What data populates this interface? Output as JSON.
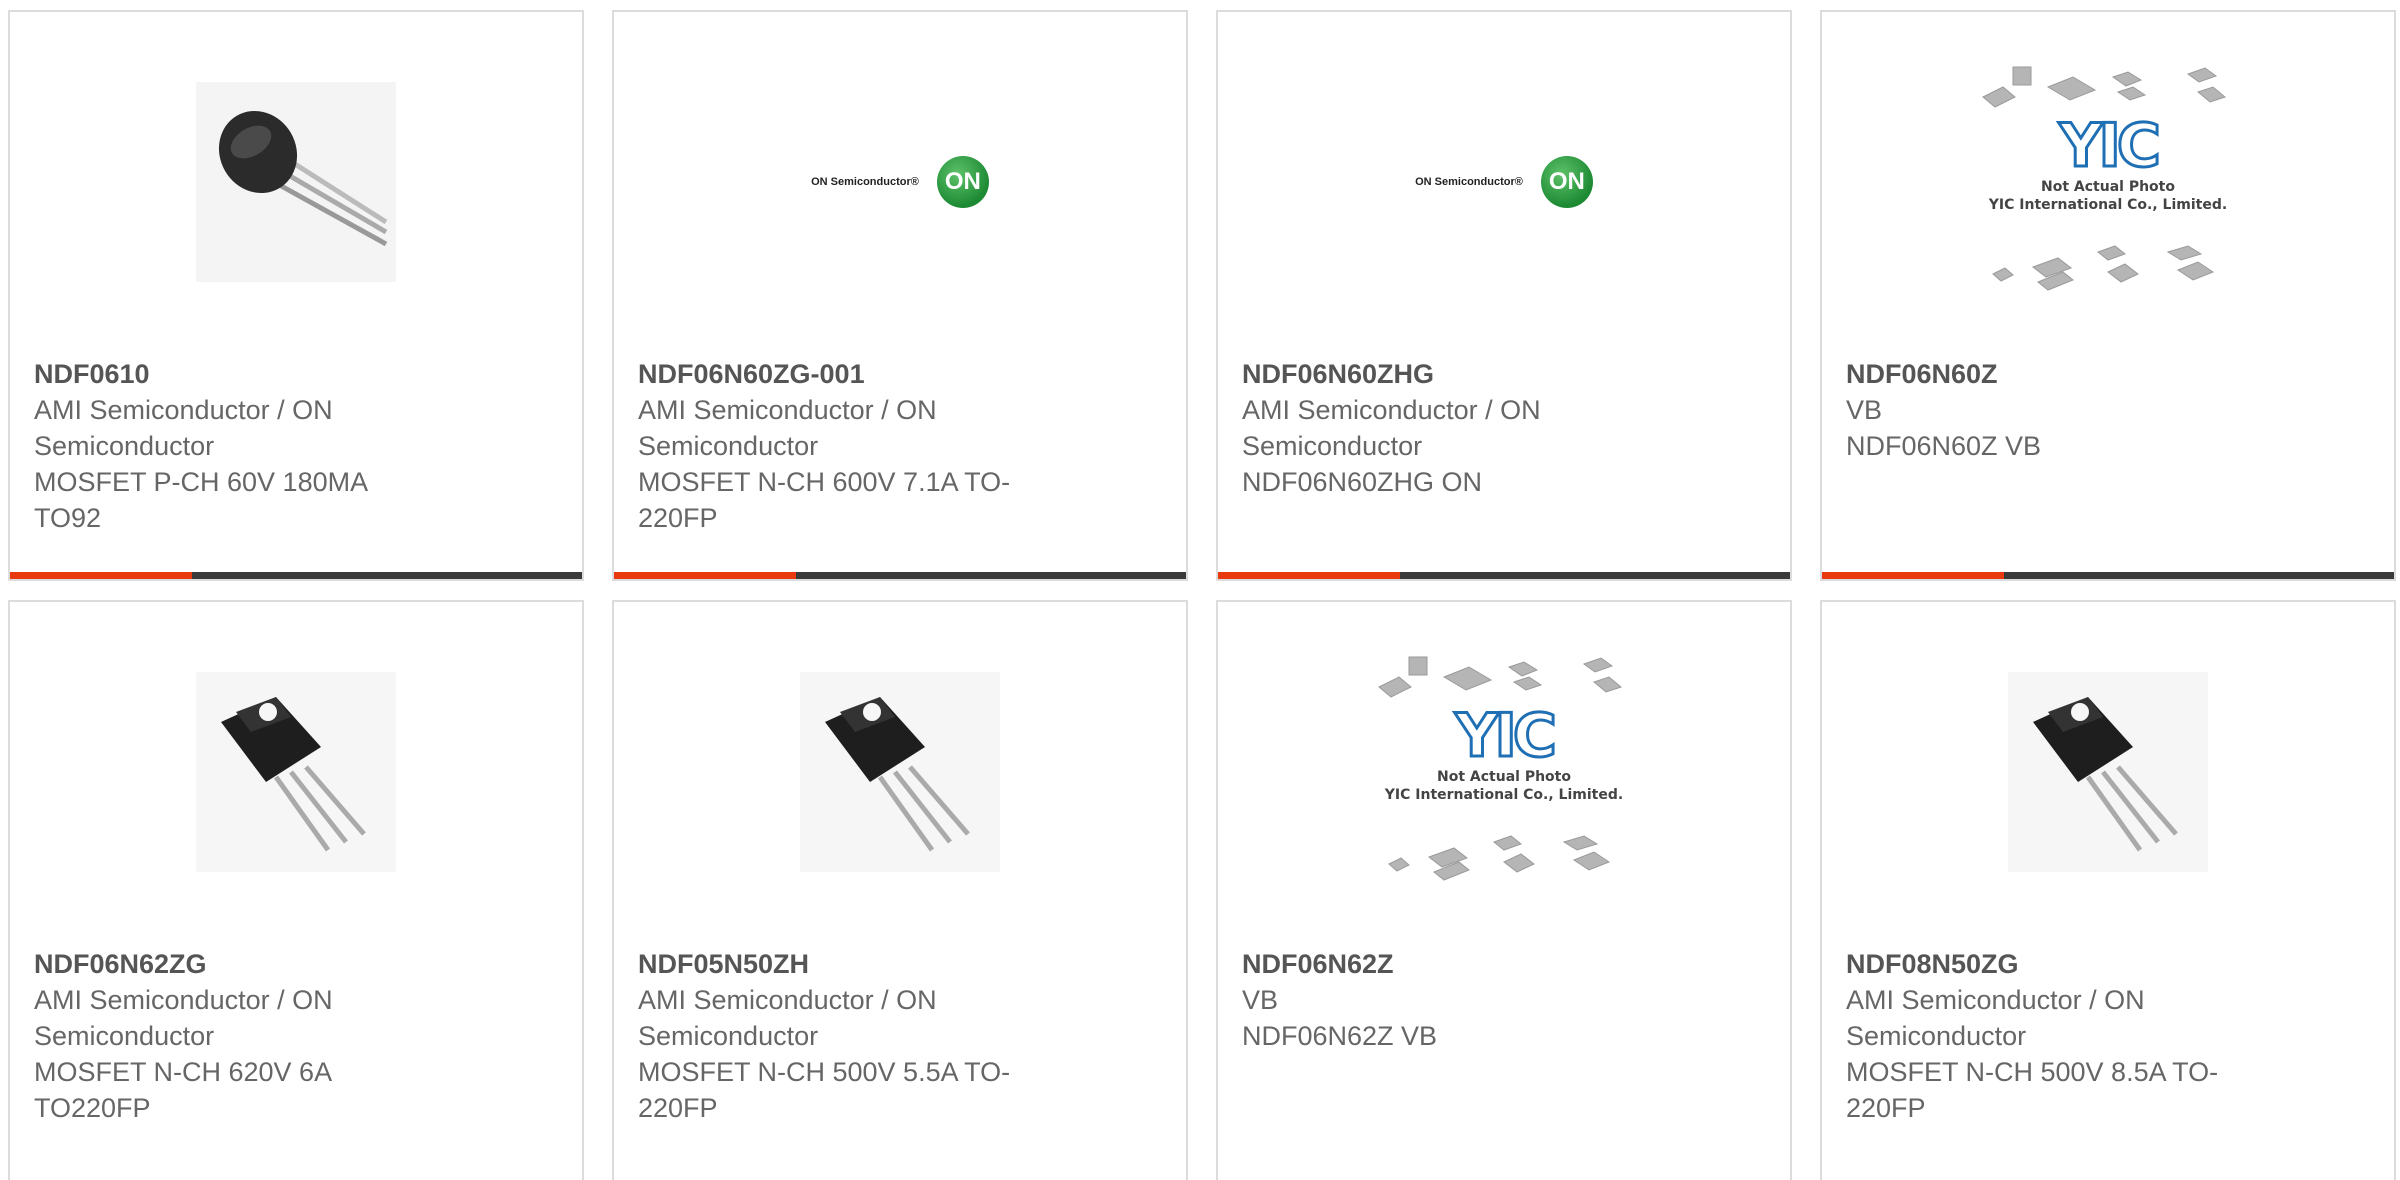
{
  "colors": {
    "accent": "#e8380d",
    "bar": "#3a3a3a",
    "border": "#dcdcdc",
    "text": "#666666"
  },
  "products": [
    {
      "part": "NDF0610",
      "mfr1": "AMI Semiconductor / ON",
      "mfr2": "Semiconductor",
      "desc1": "MOSFET P-CH 60V 180MA",
      "desc2": "TO92",
      "image": "to92-transistor-icon"
    },
    {
      "part": "NDF06N60ZG-001",
      "mfr1": "AMI Semiconductor / ON",
      "mfr2": "Semiconductor",
      "desc1": "MOSFET N-CH 600V 7.1A TO-",
      "desc2": "220FP",
      "image": "on-semiconductor-logo"
    },
    {
      "part": "NDF06N60ZHG",
      "mfr1": "AMI Semiconductor / ON",
      "mfr2": "Semiconductor",
      "desc1": "NDF06N60ZHG ON",
      "desc2": "",
      "image": "on-semiconductor-logo"
    },
    {
      "part": "NDF06N60Z",
      "mfr1": "VB",
      "mfr2": "NDF06N60Z VB",
      "desc1": "",
      "desc2": "",
      "image": "yic-not-actual-photo"
    },
    {
      "part": "NDF06N62ZG",
      "mfr1": "AMI Semiconductor / ON",
      "mfr2": "Semiconductor",
      "desc1": "MOSFET N-CH 620V 6A",
      "desc2": "TO220FP",
      "image": "to220-transistor-icon"
    },
    {
      "part": "NDF05N50ZH",
      "mfr1": "AMI Semiconductor / ON",
      "mfr2": "Semiconductor",
      "desc1": "MOSFET N-CH 500V 5.5A TO-",
      "desc2": "220FP",
      "image": "to220-transistor-icon"
    },
    {
      "part": "NDF06N62Z",
      "mfr1": "VB",
      "mfr2": "NDF06N62Z VB",
      "desc1": "",
      "desc2": "",
      "image": "yic-not-actual-photo"
    },
    {
      "part": "NDF08N50ZG",
      "mfr1": "AMI Semiconductor / ON",
      "mfr2": "Semiconductor",
      "desc1": "MOSFET N-CH 500V 8.5A TO-",
      "desc2": "220FP",
      "image": "to220-transistor-icon"
    }
  ],
  "logos": {
    "on_text": "ON Semiconductor®",
    "on_badge": "ON",
    "yic_mark": "YIC",
    "yic_line1": "Not Actual Photo",
    "yic_line2": "YIC International Co., Limited."
  }
}
